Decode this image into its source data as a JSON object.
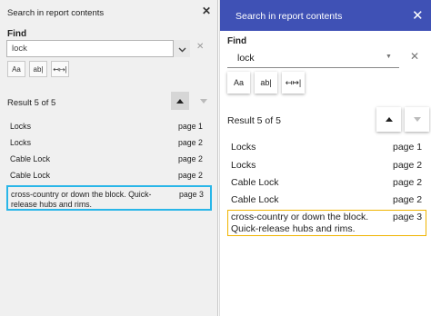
{
  "left": {
    "title": "Search in report contents",
    "close_glyph": "✕",
    "find_label": "Find",
    "search_value": "lock",
    "clear_glyph": "✕",
    "options": [
      "Aa",
      "ab|",
      "↤↦|"
    ],
    "result_text": "Result 5 of 5",
    "results": [
      {
        "text": "Locks",
        "page": "page 1"
      },
      {
        "text": "Locks",
        "page": "page 2"
      },
      {
        "text": "Cable Lock",
        "page": "page 2"
      },
      {
        "text": "Cable Lock",
        "page": "page 2"
      },
      {
        "text": "cross-country or down the block. Quick-release hubs and rims.",
        "page": "page 3"
      }
    ],
    "colors": {
      "selection_border": "#29b6e8",
      "background": "#f0f0f0"
    }
  },
  "right": {
    "title": "Search in report contents",
    "close_glyph": "✕",
    "find_label": "Find",
    "search_value": "lock",
    "clear_glyph": "✕",
    "dropdown_glyph": "▼",
    "options": [
      "Aa",
      "ab|",
      "↤↦|"
    ],
    "result_text": "Result 5 of 5",
    "results": [
      {
        "text": "Locks",
        "page": "page 1"
      },
      {
        "text": "Locks",
        "page": "page 2"
      },
      {
        "text": "Cable Lock",
        "page": "page 2"
      },
      {
        "text": "Cable Lock",
        "page": "page 2"
      },
      {
        "text": "cross-country or down the block. Quick-release hubs and rims.",
        "page": "page 3"
      }
    ],
    "colors": {
      "header": "#3f51b5",
      "selection_border": "#f0b400"
    }
  }
}
